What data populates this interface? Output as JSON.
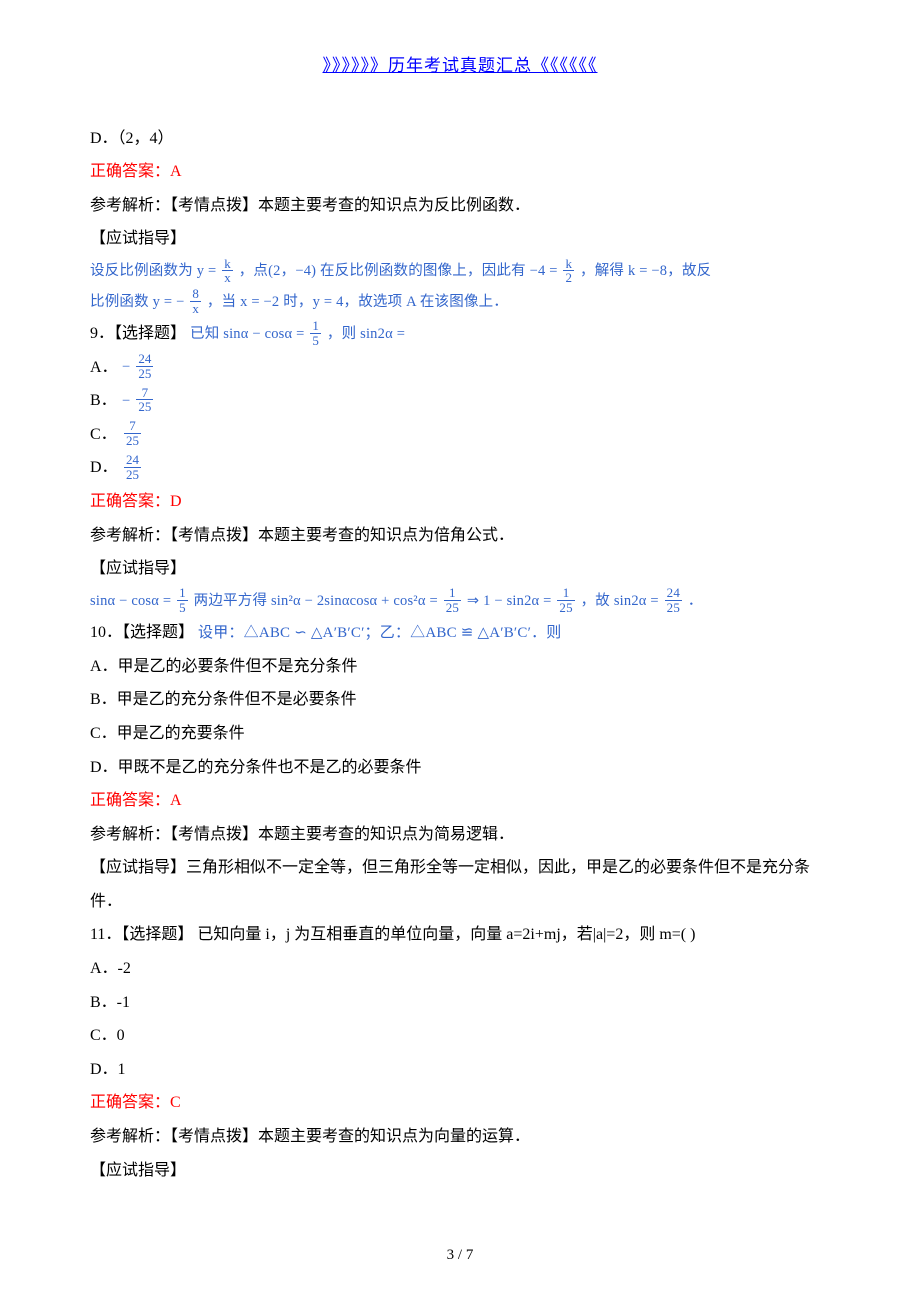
{
  "header": {
    "link_text": "》》》》》》历年考试真题汇总《《《《《《"
  },
  "q8_extra": {
    "opt_d": "D．（2，4）",
    "answer": "正确答案：A",
    "line1": "参考解析：【考情点拨】本题主要考查的知识点为反比例函数．",
    "line2": "【应试指导】",
    "expl_a_prefix": "设反比例函数为 y = ",
    "expl_a_mid1": "，点(2，−4) 在反比例函数的图像上，因此有 −4 = ",
    "expl_a_mid2": "，解得 k = −8，故反",
    "expl_b_prefix": "比例函数 y = −",
    "expl_b_mid": "，当 x = −2 时，y = 4，故选项 A 在该图像上．"
  },
  "q9": {
    "stem_prefix": "9．【选择题】",
    "stem_math_a": "已知 sinα − cosα = ",
    "stem_math_b": "，则 sin2α =",
    "opt_a_label": "A．",
    "opt_b_label": "B．",
    "opt_c_label": "C．",
    "opt_d_label": "D．",
    "answer": "正确答案：D",
    "line1": "参考解析：【考情点拨】本题主要考查的知识点为倍角公式．",
    "line2": "【应试指导】",
    "expl_a": "sinα − cosα = ",
    "expl_b": " 两边平方得 sin²α − 2sinαcosα + cos²α = ",
    "expl_c": " ⇒ 1 − sin2α = ",
    "expl_d": "，故 sin2α = ",
    "expl_e": "．"
  },
  "q10": {
    "stem_prefix": "10．【选择题】",
    "stem_math": "设甲：△ABC ∽ △A′B′C′；乙：△ABC ≌ △A′B′C′．则",
    "opt_a": "A．甲是乙的必要条件但不是充分条件",
    "opt_b": "B．甲是乙的充分条件但不是必要条件",
    "opt_c": "C．甲是乙的充要条件",
    "opt_d": "D．甲既不是乙的充分条件也不是乙的必要条件",
    "answer": "正确答案：A",
    "line1": "参考解析：【考情点拨】本题主要考查的知识点为简易逻辑．",
    "line2": "【应试指导】三角形相似不一定全等，但三角形全等一定相似，因此，甲是乙的必要条件但不是充分条",
    "line3": "件．"
  },
  "q11": {
    "stem": "11．【选择题】 已知向量 i，j 为互相垂直的单位向量，向量 a=2i+mj，若|a|=2，则 m=(    )",
    "opt_a": "A．-2",
    "opt_b": "B．-1",
    "opt_c": "C．0",
    "opt_d": "D．1",
    "answer": "正确答案：C",
    "line1": "参考解析：【考情点拨】本题主要考查的知识点为向量的运算．",
    "line2": "【应试指导】"
  },
  "footer": {
    "page_num": "3 / 7"
  },
  "fracs": {
    "k_over_x": {
      "n": "k",
      "d": "x"
    },
    "k_over_2": {
      "n": "k",
      "d": "2"
    },
    "8_over_x": {
      "n": "8",
      "d": "x"
    },
    "1_over_5": {
      "n": "1",
      "d": "5"
    },
    "24_over_25": {
      "n": "24",
      "d": "25"
    },
    "7_over_25": {
      "n": "7",
      "d": "25"
    },
    "1_over_25": {
      "n": "1",
      "d": "25"
    }
  }
}
